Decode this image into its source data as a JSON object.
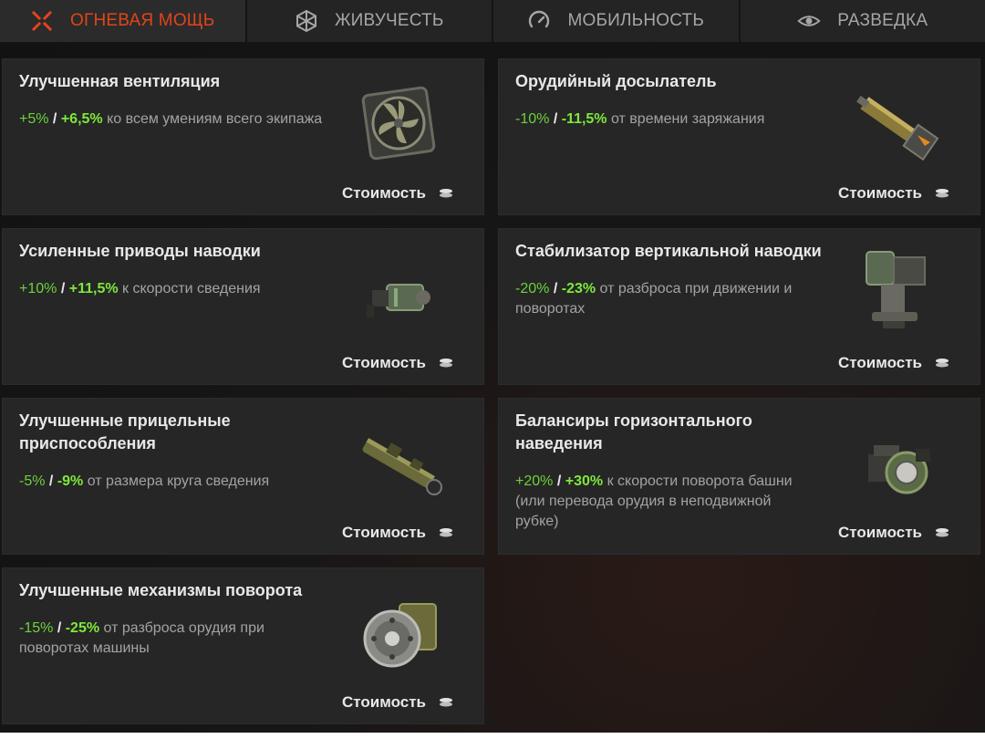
{
  "tabs": [
    {
      "label": "ОГНЕВАЯ МОЩЬ",
      "icon": "crosshair-icon",
      "active": true
    },
    {
      "label": "ЖИВУЧЕСТЬ",
      "icon": "shield-icon",
      "active": false
    },
    {
      "label": "МОБИЛЬНОСТЬ",
      "icon": "speedometer-icon",
      "active": false
    },
    {
      "label": "РАЗВЕДКА",
      "icon": "eye-icon",
      "active": false
    }
  ],
  "cost_label": "Стоимость",
  "items": [
    {
      "title": "Улучшенная вентиляция",
      "v1": "+5%",
      "sep": "/",
      "v2": "+6,5%",
      "text": "ко всем умениям всего экипажа",
      "icon": "ventilation-fan-icon"
    },
    {
      "title": "Орудийный досылатель",
      "v1": "-10%",
      "sep": "/",
      "v2": "-11,5%",
      "text": "от времени заряжания",
      "icon": "gun-rammer-icon"
    },
    {
      "title": "Усиленные приводы наводки",
      "v1": "+10%",
      "sep": "/",
      "v2": "+11,5%",
      "text": "к скорости сведения",
      "icon": "aiming-drive-icon"
    },
    {
      "title": "Стабилизатор вертикальной наводки",
      "v1": "-20%",
      "sep": "/",
      "v2": "-23%",
      "text": "от разброса при движении и поворотах",
      "icon": "stabilizer-icon"
    },
    {
      "title": "Улучшенные прицельные приспособления",
      "v1": "-5%",
      "sep": "/",
      "v2": "-9%",
      "text": "от размера круга сведения",
      "icon": "gun-sight-icon"
    },
    {
      "title": "Балансиры горизонтального наведения",
      "v1": "+20%",
      "sep": "/",
      "v2": "+30%",
      "text": "к скорости поворота башни (или перевода орудия в неподвижной рубке)",
      "icon": "traverse-balancer-icon"
    },
    {
      "title": "Улучшенные механизмы поворота",
      "v1": "-15%",
      "sep": "/",
      "v2": "-25%",
      "text": "от разброса орудия при поворотах машины",
      "icon": "turning-mechanism-icon"
    }
  ]
}
